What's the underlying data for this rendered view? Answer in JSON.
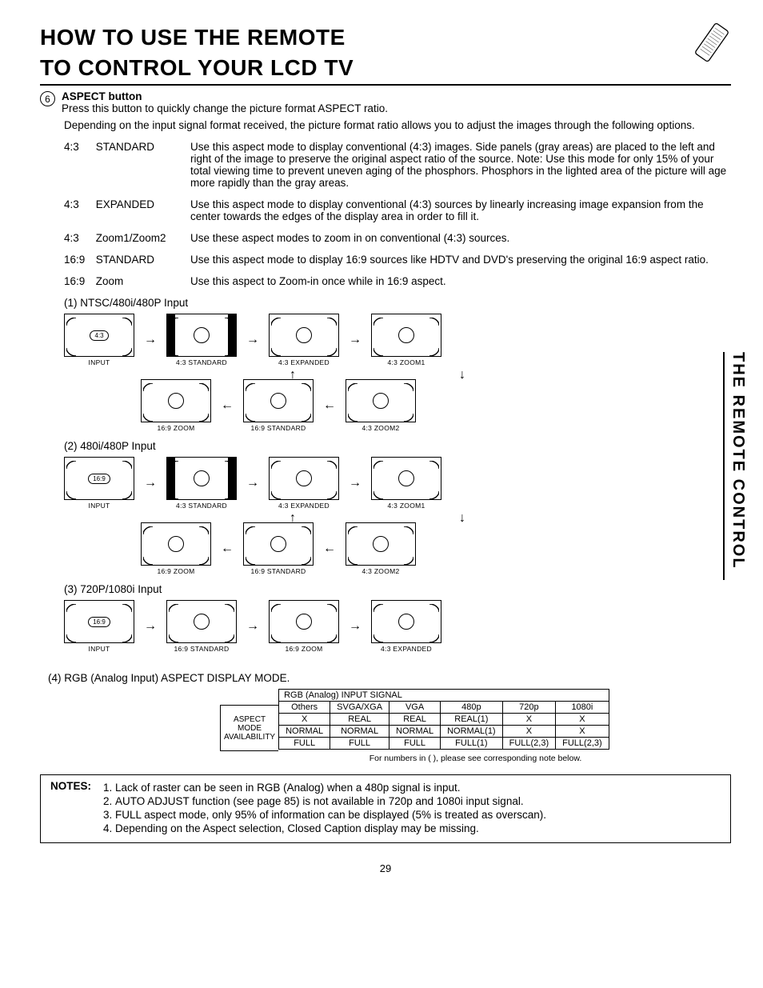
{
  "title_line1": "HOW TO USE THE REMOTE",
  "title_line2": "TO CONTROL YOUR LCD TV",
  "side_label": "THE REMOTE CONTROL",
  "section_number": "6",
  "section_title": "ASPECT button",
  "section_intro": "Press this button to quickly change the picture format ASPECT ratio.",
  "section_intro2": "Depending on the input signal format received, the picture format ratio allows you to adjust the images through the following options.",
  "aspects": [
    {
      "ratio": "4:3",
      "name": "STANDARD",
      "desc": "Use this aspect mode to display conventional (4:3) images.  Side panels (gray areas) are placed to the left and right of the image to preserve the original aspect ratio of the source.  Note:  Use this mode for only 15% of your total viewing time to prevent uneven aging of the phosphors.  Phosphors in the lighted area of the picture will age more rapidly than the gray areas."
    },
    {
      "ratio": "4:3",
      "name": "EXPANDED",
      "desc": "Use this aspect mode to display conventional (4:3) sources by linearly increasing image expansion from the center towards the edges of the display area in order to fill it."
    },
    {
      "ratio": "4:3",
      "name": "Zoom1/Zoom2",
      "desc": "Use these aspect modes to zoom in on conventional (4:3) sources."
    },
    {
      "ratio": "16:9",
      "name": "STANDARD",
      "desc": "Use this aspect mode to display 16:9 sources like HDTV and DVD's preserving the original 16:9 aspect ratio."
    },
    {
      "ratio": "16:9",
      "name": "Zoom",
      "desc": "Use this aspect to Zoom-in once while in 16:9 aspect."
    }
  ],
  "diagrams": [
    {
      "num": "(1)",
      "title": "NTSC/480i/480P Input",
      "input_tag": "4:3",
      "row1": [
        "INPUT",
        "4:3 STANDARD",
        "4:3 EXPANDED",
        "4:3 ZOOM1"
      ],
      "row2": [
        "16:9 ZOOM",
        "16:9 STANDARD",
        "4:3 ZOOM2"
      ]
    },
    {
      "num": "(2)",
      "title": "480i/480P Input",
      "input_tag": "16:9",
      "row1": [
        "INPUT",
        "4:3 STANDARD",
        "4:3 EXPANDED",
        "4:3 ZOOM1"
      ],
      "row2": [
        "16:9 ZOOM",
        "16:9 STANDARD",
        "4:3 ZOOM2"
      ]
    },
    {
      "num": "(3)",
      "title": "720P/1080i Input",
      "input_tag": "16:9",
      "row1": [
        "INPUT",
        "16:9 STANDARD",
        "16:9 ZOOM",
        "4:3 EXPANDED"
      ]
    }
  ],
  "rgb_heading": "(4)  RGB (Analog Input) ASPECT DISPLAY MODE.",
  "rgb_table": {
    "super_header": "RGB (Analog) INPUT SIGNAL",
    "row_header_lines": [
      "ASPECT",
      "MODE",
      "AVAILABILITY"
    ],
    "cols": [
      "Others",
      "SVGA/XGA",
      "VGA",
      "480p",
      "720p",
      "1080i"
    ],
    "rows": [
      [
        "X",
        "REAL",
        "REAL",
        "REAL(1)",
        "X",
        "X"
      ],
      [
        "NORMAL",
        "NORMAL",
        "NORMAL",
        "NORMAL(1)",
        "X",
        "X"
      ],
      [
        "FULL",
        "FULL",
        "FULL",
        "FULL(1)",
        "FULL(2,3)",
        "FULL(2,3)"
      ]
    ],
    "footnote": "For numbers in ( ), please see corresponding note below."
  },
  "notes_label": "NOTES:",
  "notes": [
    "Lack of raster can be seen in RGB (Analog) when a 480p signal is input.",
    "AUTO ADJUST function (see page 85) is not available in 720p and 1080i input signal.",
    "FULL aspect mode, only 95% of information can be displayed (5% is treated as overscan).",
    "Depending on the Aspect selection, Closed Caption display may be missing."
  ],
  "page_number": "29",
  "chart_data": {
    "type": "table",
    "title": "RGB (Analog Input) ASPECT DISPLAY MODE — Aspect mode availability",
    "categories": [
      "Others",
      "SVGA/XGA",
      "VGA",
      "480p",
      "720p",
      "1080i"
    ],
    "series": [
      {
        "name": "row1",
        "values": [
          "X",
          "REAL",
          "REAL",
          "REAL(1)",
          "X",
          "X"
        ]
      },
      {
        "name": "row2",
        "values": [
          "NORMAL",
          "NORMAL",
          "NORMAL",
          "NORMAL(1)",
          "X",
          "X"
        ]
      },
      {
        "name": "row3",
        "values": [
          "FULL",
          "FULL",
          "FULL",
          "FULL(1)",
          "FULL(2,3)",
          "FULL(2,3)"
        ]
      }
    ]
  }
}
